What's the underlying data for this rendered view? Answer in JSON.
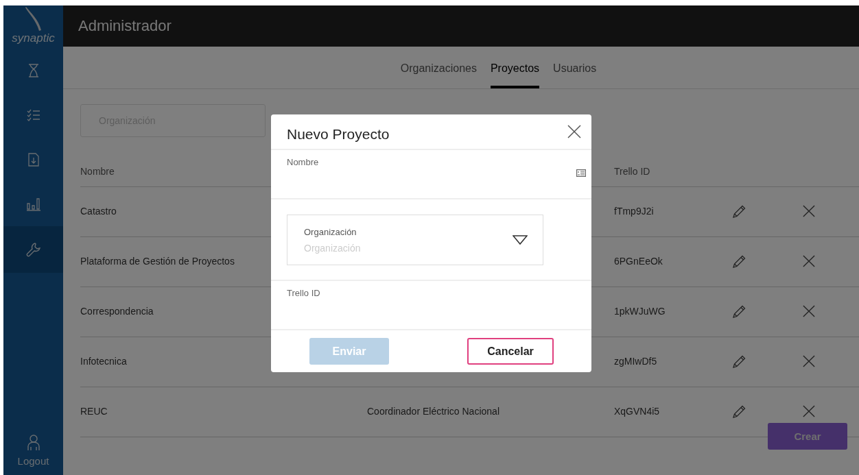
{
  "app": {
    "logo_text": "synaptic",
    "title": "Administrador"
  },
  "sidebar": {
    "items": [
      {
        "selected": false
      },
      {
        "selected": false
      },
      {
        "selected": false
      },
      {
        "selected": false
      },
      {
        "selected": true
      }
    ],
    "logout": "Logout"
  },
  "tabs": [
    {
      "label": "Organizaciones",
      "selected": false
    },
    {
      "label": "Proyectos",
      "selected": true
    },
    {
      "label": "Usuarios",
      "selected": false
    }
  ],
  "filter": {
    "placeholder": "Organización"
  },
  "table": {
    "columns": [
      "Nombre",
      "Trello ID"
    ],
    "rows": [
      {
        "name": "Catastro",
        "trello_id": "fTmp9J2i"
      },
      {
        "name": "Plataforma de Gestión de Proyectos",
        "trello_id": "6PGnEeOk"
      },
      {
        "name": "Correspondencia",
        "trello_id": "1pkWJuWG"
      },
      {
        "name": "Infotecnica",
        "trello_id": "zgMIwDf5"
      },
      {
        "name": "REUC",
        "organization": "Coordinador Eléctrico Nacional",
        "trello_id": "XqGVN4i5"
      }
    ]
  },
  "create_button": "Crear",
  "modal": {
    "title": "Nuevo Proyecto",
    "name_field": {
      "label": "Nombre"
    },
    "organization_field": {
      "label": "Organización",
      "placeholder": "Organización"
    },
    "trello_field": {
      "label": "Trello ID"
    },
    "submit": {
      "label": "Enviar",
      "disabled": true
    },
    "cancel": {
      "label": "Cancelar"
    }
  }
}
